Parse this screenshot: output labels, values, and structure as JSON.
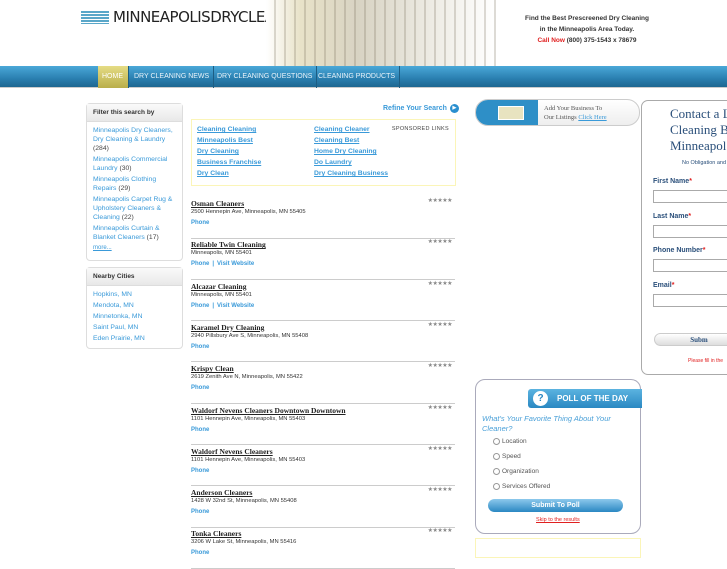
{
  "header": {
    "logo": "MINNEAPOLISDRYCLEANING.COM",
    "tagline1": "Find the Best Prescreened Dry Cleaning",
    "tagline2": "in the Minneapolis Area Today.",
    "call_label": "Call Now",
    "phone": "(800) 375-1543 x 78679"
  },
  "nav": [
    "HOME",
    "DRY CLEANING NEWS",
    "DRY CLEANING QUESTIONS",
    "CLEANING PRODUCTS"
  ],
  "filter": {
    "title": "Filter this search by",
    "items": [
      {
        "label": "Minneapolis Dry Cleaners, Dry Cleaning & Laundry",
        "count": "(284)"
      },
      {
        "label": "Minneapolis Commercial Laundry",
        "count": "(30)"
      },
      {
        "label": "Minneapolis Clothing Repairs",
        "count": "(29)"
      },
      {
        "label": "Minneapolis Carpet Rug & Upholstery Cleaners & Cleaning",
        "count": "(22)"
      },
      {
        "label": "Minneapolis Curtain & Blanket Cleaners",
        "count": "(17)"
      }
    ],
    "more": "more..."
  },
  "nearby": {
    "title": "Nearby Cities",
    "items": [
      "Hopkins, MN",
      "Mendota, MN",
      "Minnetonka, MN",
      "Saint Paul, MN",
      "Eden Prairie, MN"
    ]
  },
  "refine": "Refine Your Search",
  "sponsored": {
    "label": "SPONSORED LINKS",
    "links": [
      "Cleaning Cleaning",
      "Minneapolis Best",
      "Dry Cleaning",
      "Business Franchise",
      "Dry Clean",
      "Cleaning Cleaner",
      "Cleaning Best",
      "Home Dry Cleaning",
      "Do Laundry",
      "Dry Cleaning Business"
    ]
  },
  "stars": "★★★★★",
  "phone_label": "Phone",
  "sep": "|",
  "visit_label": "Visit Website",
  "listings": [
    {
      "name": "Osman Cleaners",
      "address": "2500 Hennepin Ave, Minneapolis, MN 55405",
      "website": false
    },
    {
      "name": "Reliable Twin Cleaning",
      "address": "Minneapolis, MN 55401",
      "website": true
    },
    {
      "name": "Alcazar Cleaning",
      "address": "Minneapolis, MN 55401",
      "website": true
    },
    {
      "name": "Karamel Dry Cleaning",
      "address": "2940 Pillsbury Ave S, Minneapolis, MN 55408",
      "website": false
    },
    {
      "name": "Krispy Clean",
      "address": "2619 Zenith Ave N, Minneapolis, MN 55422",
      "website": false
    },
    {
      "name": "Waldorf Nevens Cleaners Downtown Downtown",
      "address": "1101 Hennepin Ave, Minneapolis, MN 55403",
      "website": false
    },
    {
      "name": "Waldorf Nevens Cleaners",
      "address": "1101 Hennepin Ave, Minneapolis, MN 55403",
      "website": false
    },
    {
      "name": "Anderson Cleaners",
      "address": "1428 W 32nd St, Minneapolis, MN 55408",
      "website": false
    },
    {
      "name": "Tonka Cleaners",
      "address": "3206 W Lake St, Minneapolis, MN 55416",
      "website": false
    }
  ],
  "addbiz": {
    "line1": "Add Your Business To",
    "line2": "Our Listings",
    "link": "Click Here"
  },
  "form": {
    "title1": "Contact a L",
    "title2": "Cleaning Bu",
    "title3": "Minneapol",
    "sub": "No Obligation and",
    "fields": [
      "First Name",
      "Last Name",
      "Phone Number",
      "Email"
    ],
    "req": "*",
    "submit": "Subm",
    "note": "Please fill in the"
  },
  "poll": {
    "title": "POLL OF THE DAY",
    "icon": "?",
    "question": "What's Your Favorite Thing About Your Cleaner?",
    "options": [
      "Location",
      "Speed",
      "Organization",
      "Services Offered"
    ],
    "submit": "Submit To Poll",
    "skip": "Skip to the results"
  }
}
